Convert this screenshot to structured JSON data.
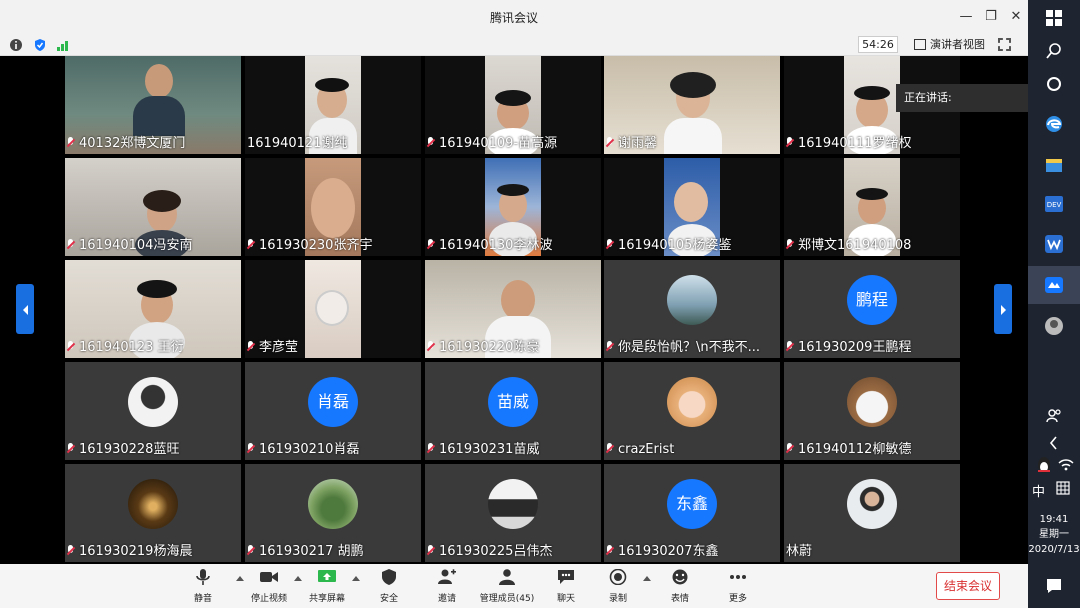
{
  "window": {
    "title": "腾讯会议"
  },
  "toolbar_strip": {
    "timer": "54:26",
    "view_button": "演讲者视图"
  },
  "speaking_label": "正在讲话:",
  "participants": [
    "40132郑博文厦门",
    "161940121谢纯",
    "161940109-苗高源",
    "谢雨馨",
    "161940111罗绪权",
    "161940104冯安南",
    "161930230张齐宇",
    "161940130李林波",
    "161940105杨姿鉴",
    "郑博文161940108",
    "161940123 王衍",
    "李彦莹",
    "161930220陈豪",
    "你是段怡帆？\\n不我不...",
    "161930209王鹏程",
    "161930228蓝旺",
    "161930210肖磊",
    "161930231苗威",
    "crazErist",
    "161940112柳敏德",
    "161930219杨海晨",
    "161930217 胡鹏",
    "161930225吕伟杰",
    "161930207东鑫",
    "林蔚"
  ],
  "avatars": {
    "pengcheng": "鹏程",
    "xiaolei": "肖磊",
    "miaowei": "苗威",
    "dongxin": "东鑫"
  },
  "bottom_toolbar": {
    "mute": "静音",
    "stop_video": "停止视频",
    "share_screen": "共享屏幕",
    "security": "安全",
    "invite": "邀请",
    "manage_members": "管理成员(45)",
    "chat": "聊天",
    "record": "录制",
    "reactions": "表情",
    "more": "更多",
    "end_meeting": "结束会议"
  },
  "taskbar": {
    "ime": "中",
    "time": "19:41",
    "weekday": "星期一",
    "date": "2020/7/13"
  },
  "colors": {
    "accent": "#1677ff",
    "end_red": "#d93030",
    "tile_bg": "#3a3a3a"
  }
}
